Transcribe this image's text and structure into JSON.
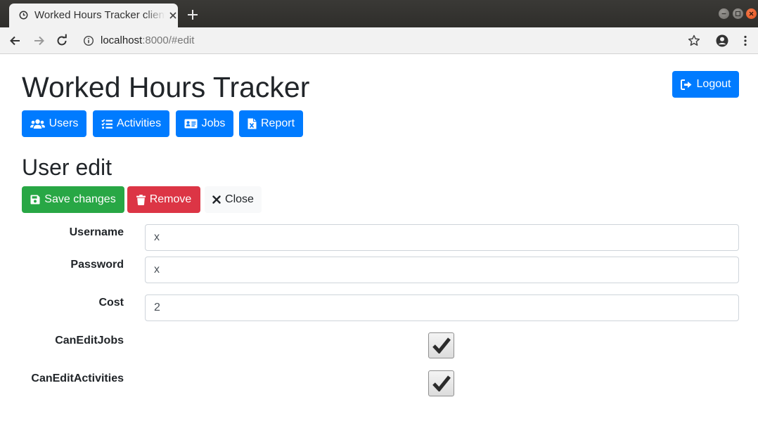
{
  "browser": {
    "tab_title": "Worked Hours Tracker client",
    "url_host": "localhost",
    "url_rest": ":8000/#edit"
  },
  "app": {
    "title": "Worked Hours Tracker",
    "logout_label": "Logout",
    "nav": {
      "users": "Users",
      "activities": "Activities",
      "jobs": "Jobs",
      "report": "Report"
    }
  },
  "editor": {
    "title": "User edit",
    "save_label": "Save changes",
    "remove_label": "Remove",
    "close_label": "Close",
    "fields": {
      "username": {
        "label": "Username",
        "value": "x"
      },
      "password": {
        "label": "Password",
        "value": "x"
      },
      "cost": {
        "label": "Cost",
        "value": "2"
      },
      "can_edit_jobs": {
        "label": "CanEditJobs",
        "checked": true
      },
      "can_edit_activities": {
        "label": "CanEditActivities",
        "checked": true
      }
    }
  },
  "colors": {
    "primary": "#007bff",
    "success": "#28a745",
    "danger": "#dc3545",
    "light": "#f8f9fa"
  }
}
